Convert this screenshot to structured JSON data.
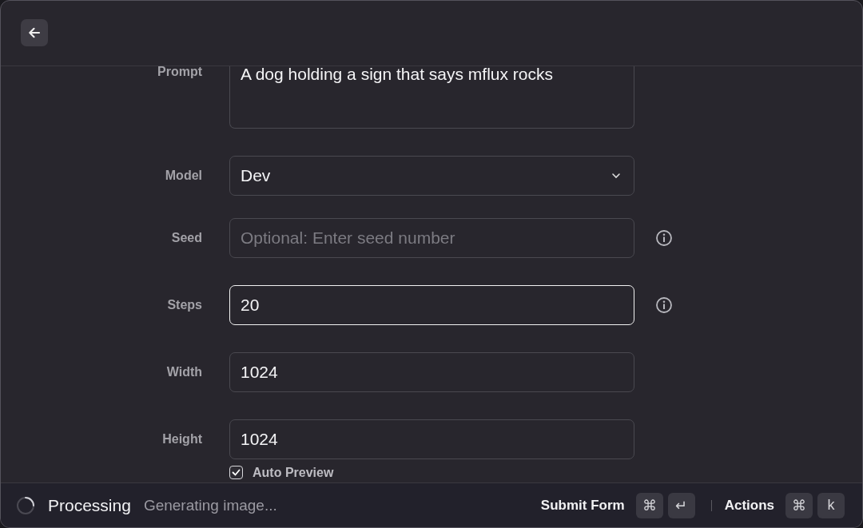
{
  "fields": [
    {
      "kind": "textarea",
      "label": "Prompt",
      "value": "A dog holding a sign that says mflux rocks",
      "info": false,
      "focused": false
    },
    {
      "kind": "dropdown",
      "label": "Model",
      "value": "Dev",
      "info": false,
      "focused": false
    },
    {
      "kind": "text",
      "label": "Seed",
      "placeholder": "Optional: Enter seed number",
      "info": true,
      "focused": false
    },
    {
      "kind": "text",
      "label": "Steps",
      "value": "20",
      "info": true,
      "focused": true
    },
    {
      "kind": "text",
      "label": "Width",
      "value": "1024",
      "info": false,
      "focused": false
    },
    {
      "kind": "text",
      "label": "Height",
      "value": "1024",
      "info": false,
      "focused": false
    }
  ],
  "checkbox": {
    "label": "Auto Preview",
    "checked": true
  },
  "status_bar": {
    "loading": true,
    "title": "Processing",
    "subtitle": "Generating image...",
    "actions": [
      {
        "label": "Submit Form",
        "keys": [
          "⌘",
          "↵"
        ]
      },
      {
        "label": "Actions",
        "keys": [
          "⌘",
          "k"
        ]
      }
    ]
  }
}
